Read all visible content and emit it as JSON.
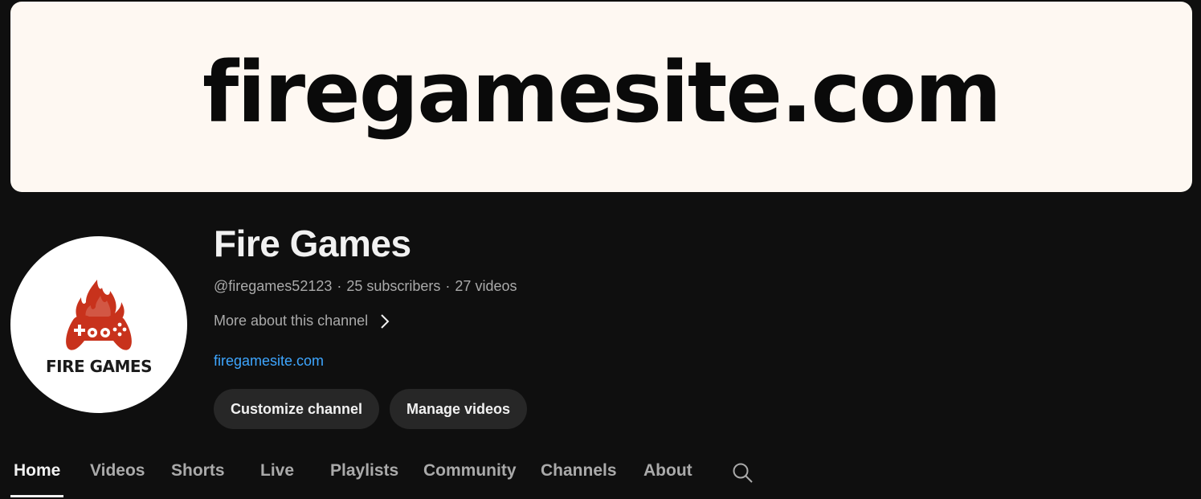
{
  "banner": {
    "text": "firegamesite.com"
  },
  "avatar": {
    "logo_text": "FIRE GAMES",
    "icon": "flaming-gamepad-icon",
    "accent_color": "#c8321c"
  },
  "channel": {
    "name": "Fire Games",
    "handle": "@firegames52123",
    "subscribers": "25 subscribers",
    "videos": "27 videos",
    "more_about": "More about this channel",
    "link": "firegamesite.com",
    "separator": "·"
  },
  "buttons": {
    "customize": "Customize channel",
    "manage": "Manage videos"
  },
  "tabs": [
    {
      "label": "Home",
      "active": true
    },
    {
      "label": "Videos"
    },
    {
      "label": "Shorts"
    },
    {
      "label": "Live"
    },
    {
      "label": "Playlists"
    },
    {
      "label": "Community"
    },
    {
      "label": "Channels"
    },
    {
      "label": "About"
    }
  ],
  "tab_search_icon": "search-icon",
  "colors": {
    "background": "#0f0f0f",
    "link": "#3ea6ff",
    "button_bg": "#272727",
    "banner_bg": "#fef8f2"
  }
}
